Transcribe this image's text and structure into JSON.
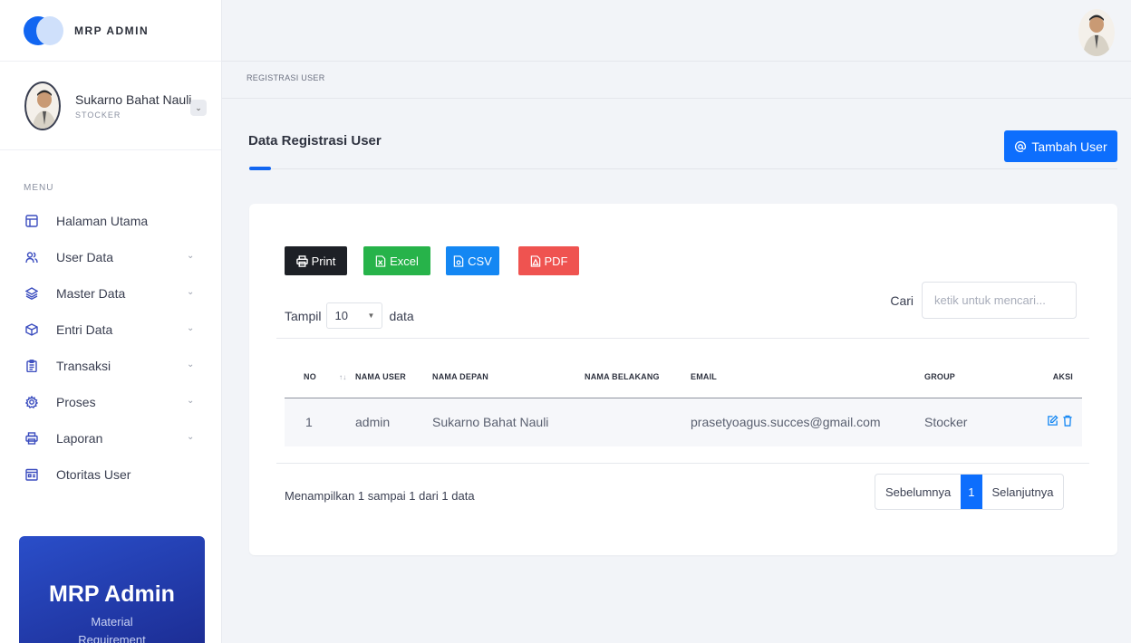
{
  "brand": {
    "name": "MRP ADMIN"
  },
  "user": {
    "name": "Sukarno Bahat Nauli",
    "role": "STOCKER"
  },
  "sidebar": {
    "menu_heading": "MENU",
    "items": [
      {
        "label": "Halaman Utama",
        "icon": "layout-icon",
        "has_submenu": false
      },
      {
        "label": "User Data",
        "icon": "users-icon",
        "has_submenu": true
      },
      {
        "label": "Master Data",
        "icon": "layers-icon",
        "has_submenu": true
      },
      {
        "label": "Entri Data",
        "icon": "package-icon",
        "has_submenu": true
      },
      {
        "label": "Transaksi",
        "icon": "clipboard-icon",
        "has_submenu": true
      },
      {
        "label": "Proses",
        "icon": "gear-icon",
        "has_submenu": true
      },
      {
        "label": "Laporan",
        "icon": "printer-icon",
        "has_submenu": true
      },
      {
        "label": "Otoritas User",
        "icon": "calendar-icon",
        "has_submenu": false
      }
    ],
    "promo": {
      "title": "MRP Admin",
      "subtitle_line1": "Material",
      "subtitle_line2": "Requirement"
    }
  },
  "breadcrumb": "REGISTRASI USER",
  "page": {
    "title": "Data Registrasi User",
    "add_button": "Tambah User"
  },
  "toolbar": {
    "print": "Print",
    "excel": "Excel",
    "csv": "CSV",
    "pdf": "PDF"
  },
  "length": {
    "prefix": "Tampil",
    "value": "10",
    "suffix": "data"
  },
  "search": {
    "label": "Cari",
    "placeholder": "ketik untuk mencari..."
  },
  "table": {
    "headers": [
      "NO",
      "NAMA USER",
      "NAMA DEPAN",
      "NAMA BELAKANG",
      "EMAIL",
      "GROUP",
      "AKSI"
    ],
    "rows": [
      {
        "no": "1",
        "nama_user": "admin",
        "nama_depan": "Sukarno Bahat Nauli",
        "nama_belakang": "",
        "email": "prasetyoagus.succes@gmail.com",
        "group": "Stocker"
      }
    ]
  },
  "info": "Menampilkan 1 sampai 1 dari 1 data",
  "pagination": {
    "prev": "Sebelumnya",
    "current": "1",
    "next": "Selanjutnya"
  },
  "colors": {
    "primary": "#0d6efd",
    "excel": "#27b34a",
    "csv": "#1487f3",
    "pdf": "#ef5350",
    "print": "#1d2026",
    "promo": "#2a4ec9"
  }
}
